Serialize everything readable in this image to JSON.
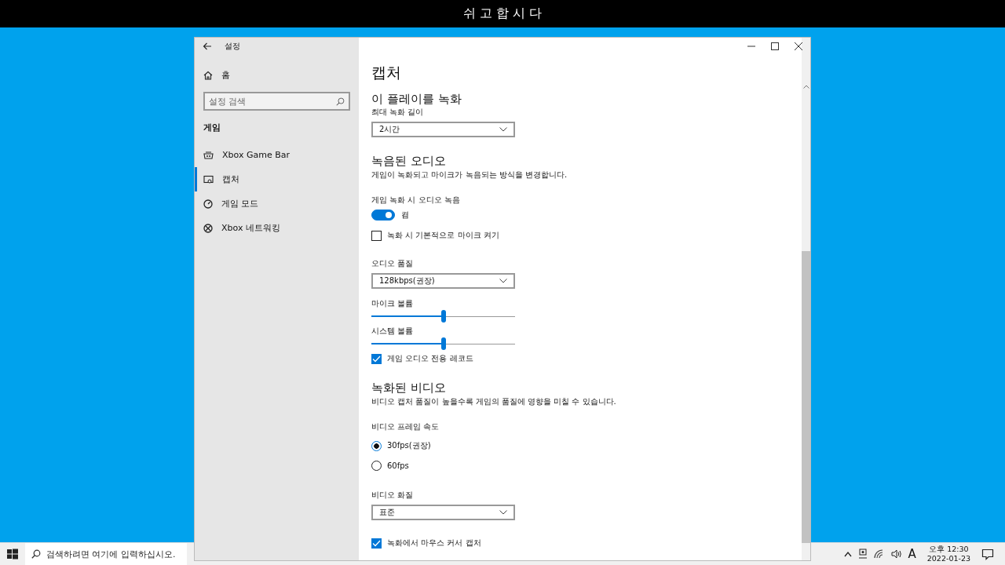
{
  "banner": {
    "text": "쉬 고 합 시 다"
  },
  "window": {
    "title": "설정"
  },
  "sidebar": {
    "home": "홈",
    "search": {
      "placeholder": "설정 검색"
    },
    "section": "게임",
    "items": [
      {
        "label": "Xbox Game Bar",
        "selected": false
      },
      {
        "label": "캡처",
        "selected": true
      },
      {
        "label": "게임 모드",
        "selected": false
      },
      {
        "label": "Xbox 네트워킹",
        "selected": false
      }
    ]
  },
  "page": {
    "title": "캡처",
    "sections": [
      {
        "title": "이 플레이를 녹화",
        "controls": [
          {
            "kind": "dropdown",
            "label": "최대 녹화 길이",
            "value": "2시간"
          }
        ]
      },
      {
        "title": "녹음된 오디오",
        "description": "게임이 녹화되고 마이크가 녹음되는 방식을 변경합니다.",
        "controls": [
          {
            "kind": "toggle",
            "label": "게임 녹화 시 오디오 녹음",
            "on": true,
            "state_text": "켬"
          },
          {
            "kind": "checkbox",
            "label": "녹화 시 기본적으로 마이크 켜기",
            "checked": false
          },
          {
            "kind": "dropdown",
            "label": "오디오 품질",
            "value": "128kbps(권장)"
          },
          {
            "kind": "slider",
            "label": "마이크 볼륨",
            "level": 0.5
          },
          {
            "kind": "slider",
            "label": "시스템 볼륨",
            "level": 0.5
          },
          {
            "kind": "checkbox",
            "label": "게임 오디오 전용 레코드",
            "checked": true
          }
        ]
      },
      {
        "title": "녹화된 비디오",
        "description": "비디오 캡처 품질이 높을수록 게임의 품질에 영향을 미칠 수 있습니다.",
        "controls": [
          {
            "kind": "radio",
            "label": "비디오 프레임 속도",
            "options": [
              {
                "label": "30fps(권장)",
                "selected": true
              },
              {
                "label": "60fps",
                "selected": false
              }
            ]
          },
          {
            "kind": "dropdown",
            "label": "비디오 화질",
            "value": "표준"
          },
          {
            "kind": "checkbox",
            "label": "녹화에서 마우스 커서 캡처",
            "checked": true
          }
        ]
      }
    ]
  },
  "taskbar": {
    "search": {
      "placeholder": "검색하려면 여기에 입력하십시오."
    },
    "ime": "A",
    "time": "오후 12:30",
    "date": "2022-01-23"
  }
}
